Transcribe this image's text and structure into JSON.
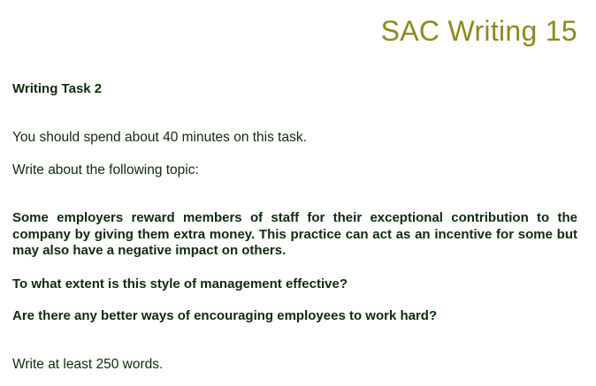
{
  "header": {
    "title": "SAC Writing 15"
  },
  "task": {
    "heading": "Writing Task 2",
    "time_instruction": "You should spend about 40 minutes on this task.",
    "topic_instruction": "Write about the following topic:",
    "statement": "Some employers reward members of staff for their exceptional contribution to the company by giving them extra money. This practice can act as an incentive for some but may also have a negative impact on others.",
    "question_1": "To what extent is this style of management effective?",
    "question_2": "Are there any better ways of encouraging employees to work hard?",
    "word_count_instruction": "Write at least 250 words."
  },
  "colors": {
    "title": "#8c8a1c",
    "text": "#0d2b0d"
  }
}
